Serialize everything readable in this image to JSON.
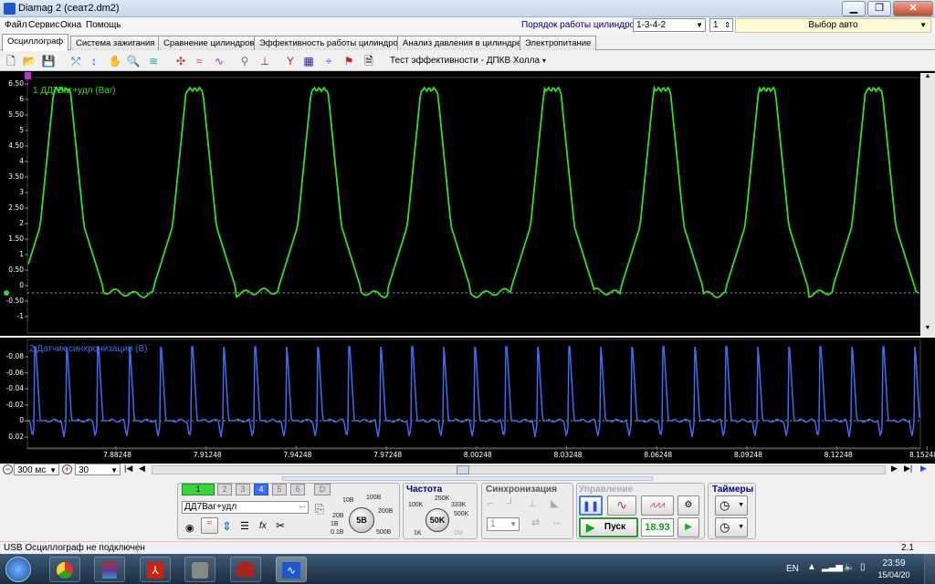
{
  "window": {
    "title": "Diamag 2 (сеат2.dm2)",
    "min_icon": "minimize-icon",
    "max_icon": "maximize-icon",
    "close_label": "✕"
  },
  "menu": {
    "items": [
      "Файл",
      "Сервис",
      "Окна",
      "Помощь"
    ]
  },
  "cylinders": {
    "order_label": "Порядок работы цилиндров",
    "order_value": "1-3-4-2",
    "cylinder_value": "1",
    "auto_select": "Выбор авто"
  },
  "tabs": [
    "Осциллограф",
    "Система зажигания",
    "Сравнение цилиндров",
    "Эффективность работы цилиндров",
    "Анализ давления в цилиндре",
    "Электропитание"
  ],
  "toolbar": {
    "test_label": "Тест эффективности - ДПКВ Холла"
  },
  "plot_top": {
    "channel_label": "1 ДД7Ваг+удл (Bar)",
    "color": "#33dd22",
    "y_ticks": [
      "6.50",
      "6",
      "5.50",
      "5",
      "4.50",
      "4",
      "3.50",
      "3",
      "2.50",
      "2",
      "1.50",
      "1",
      "0.50",
      "0",
      "-0.50",
      "-1"
    ],
    "marker": "1"
  },
  "plot_bottom": {
    "channel_label": "2 Датчик синхронизации (В)",
    "color": "#3d6df0",
    "y_ticks": [
      "-0.08",
      "-0.06",
      "-0.04",
      "-0.02",
      "0",
      "0.02"
    ]
  },
  "x_axis": {
    "ticks": [
      "7.88248",
      "7.91248",
      "7.94248",
      "7.97248",
      "8.00248",
      "8.03248",
      "8.06248",
      "8.09248",
      "8.12248",
      "8.15248"
    ]
  },
  "scroll": {
    "timebase": "300 мс",
    "count": "30"
  },
  "channels": {
    "buttons": [
      "1",
      "2",
      "3",
      "4",
      "5",
      "6",
      "D"
    ],
    "active": [
      "1",
      "4"
    ]
  },
  "sensor": {
    "name": "ДД7Ваг+удл",
    "scale_labels": [
      "10В",
      "100В",
      "20В",
      "200В",
      "0.1В",
      "500В",
      "1В"
    ],
    "scale_value": "5В"
  },
  "frequency": {
    "title": "Частота",
    "labels": [
      "250K",
      "100K",
      "333K",
      "500K",
      "1K",
      "1M"
    ],
    "value": "50K"
  },
  "sync": {
    "title": "Синхронизация",
    "channel": "1"
  },
  "control": {
    "title": "Управление",
    "start_label": "Пуск",
    "value": "18.93"
  },
  "timers": {
    "title": "Таймеры"
  },
  "status": {
    "left": "USB Осциллограф не подключен",
    "right": "2.1"
  },
  "taskbar": {
    "lang": "EN",
    "time": "23:59",
    "date": "15/04/20"
  }
}
